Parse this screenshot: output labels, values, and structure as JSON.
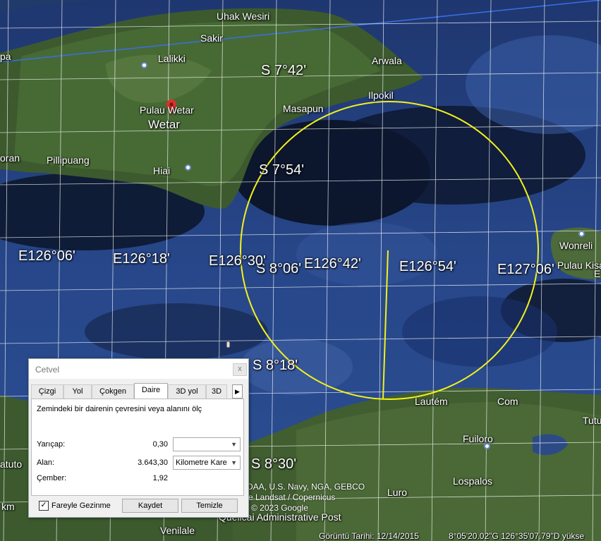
{
  "map": {
    "grid_labels": {
      "lat_7_42": "S 7°42'",
      "lat_7_54": "S 7°54'",
      "lat_8_06": "S 8°06'",
      "lat_8_18": "S 8°18'",
      "lat_8_30": "S 8°30'",
      "lon_126_06": "E126°06'",
      "lon_126_18": "E126°18'",
      "lon_126_30": "E126°30'",
      "lon_126_42": "E126°42'",
      "lon_126_54": "E126°54'",
      "lon_127_06": "E127°06'"
    },
    "places": {
      "uhak": "Uhak Wesiri",
      "sakir": "Sakir",
      "lalikki": "Lalikki",
      "arwala": "Arwala",
      "ilpokil": "Ilpokil",
      "masapun": "Masapun",
      "pulau_wetar": "Pulau Wetar",
      "wetar": "Wetar",
      "oran": "oran",
      "pillipuang": "Pillipuang",
      "hiai": "Hiai",
      "wonreli": "Wonreli",
      "pulau_kisa": "Pulau Kisa",
      "e": "E",
      "pa": "pa",
      "lautem": "Lautém",
      "com": "Com",
      "tutu": "Tutu",
      "fuiloro": "Fuiloro",
      "lospalos": "Lospalos",
      "luro": "Luro",
      "atuto": "atuto",
      "km": "km",
      "venilale": "Venilale",
      "quelicai": "Quelicai Administrative Post"
    },
    "attribution": {
      "line1": "DAA, U.S. Navy, NGA, GEBCO",
      "line2": "e Landsat / Copernicus",
      "line3": "© 2023 Google"
    },
    "colors": {
      "circle": "#f2f21a",
      "grid": "#ffffff",
      "border": "#3a6ee8"
    }
  },
  "ruler": {
    "title": "Cetvel",
    "close": "x",
    "tabs": [
      "Çizgi",
      "Yol",
      "Çokgen",
      "Daire",
      "3D yol",
      "3D"
    ],
    "active_tab": "Daire",
    "tab_scroll": "▶",
    "description": "Zemindeki bir dairenin çevresini veya alanını ölç",
    "radius_label": "Yarıçap:",
    "radius_value": "0,30",
    "radius_unit": "",
    "area_label": "Alan:",
    "area_value": "3.643,30",
    "area_unit": "Kilometre Kare",
    "circumference_label": "Çember:",
    "circumference_value": "1,92",
    "mouse_nav_label": "Fareyle Gezinme",
    "mouse_nav_checked": "✓",
    "save_label": "Kaydet",
    "clear_label": "Temizle"
  },
  "status": {
    "imagery_date": "Görüntü Tarihi: 12/14/2015",
    "coords": "8°05'20.02\"G   126°35'07.79\"D   yükse"
  }
}
